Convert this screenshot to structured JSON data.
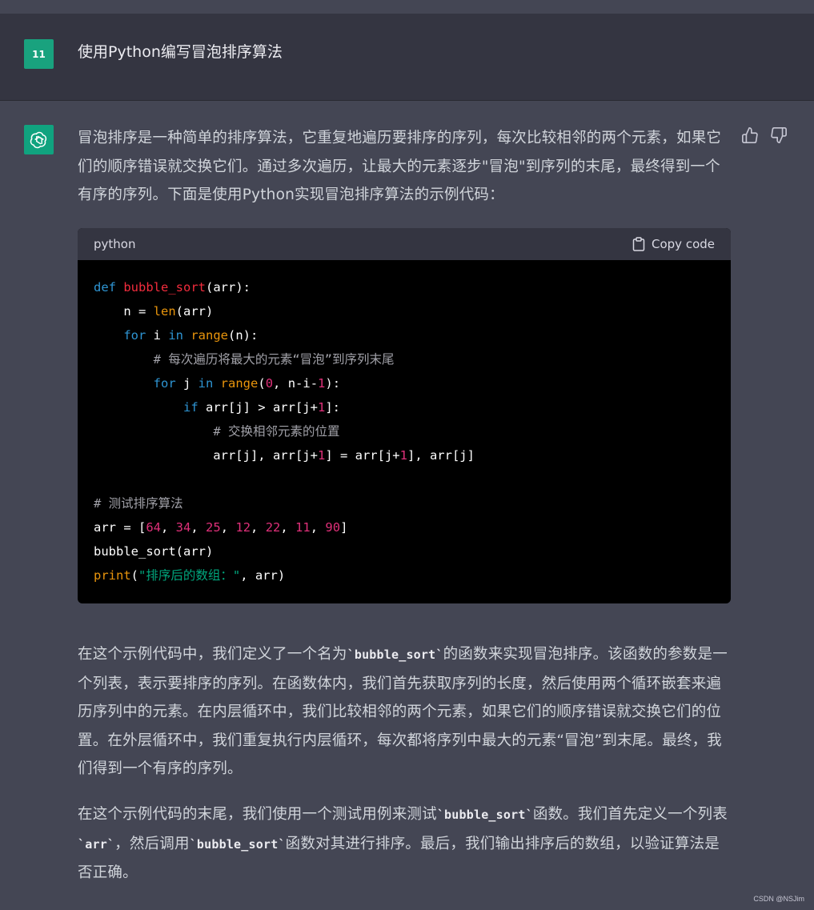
{
  "user_message": {
    "avatar_text": "11",
    "text": "使用Python编写冒泡排序算法"
  },
  "assistant": {
    "avatar_icon": "openai-logo-icon",
    "intro": "冒泡排序是一种简单的排序算法，它重复地遍历要排序的序列，每次比较相邻的两个元素，如果它们的顺序错误就交换它们。通过多次遍历，让最大的元素逐步\"冒泡\"到序列的末尾，最终得到一个有序的序列。下面是使用Python实现冒泡排序算法的示例代码：",
    "code": {
      "language": "python",
      "copy_label": "Copy code",
      "lines": [
        "def bubble_sort(arr):",
        "    n = len(arr)",
        "    for i in range(n):",
        "        # 每次遍历将最大的元素“冒泡”到序列末尾",
        "        for j in range(0, n-i-1):",
        "            if arr[j] > arr[j+1]:",
        "                # 交换相邻元素的位置",
        "                arr[j], arr[j+1] = arr[j+1], arr[j]",
        "",
        "# 测试排序算法",
        "arr = [64, 34, 25, 12, 22, 11, 90]",
        "bubble_sort(arr)",
        "print(\"排序后的数组：\", arr)"
      ]
    },
    "para2": {
      "a": "在这个示例代码中，我们定义了一个名为",
      "code1": "`bubble_sort`",
      "b": "的函数来实现冒泡排序。该函数的参数是一个列表，表示要排序的序列。在函数体内，我们首先获取序列的长度，然后使用两个循环嵌套来遍历序列中的元素。在内层循环中，我们比较相邻的两个元素，如果它们的顺序错误就交换它们的位置。在外层循环中，我们重复执行内层循环，每次都将序列中最大的元素“冒泡”到末尾。最终，我们得到一个有序的序列。"
    },
    "para3": {
      "a": "在这个示例代码的末尾，我们使用一个测试用例来测试",
      "code1": "`bubble_sort`",
      "b": "函数。我们首先定义一个列表",
      "code2": "`arr`",
      "c": "，然后调用",
      "code3": "`bubble_sort`",
      "d": "函数对其进行排序。最后，我们输出排序后的数组，以验证算法是否正确。"
    }
  },
  "feedback": {
    "like_icon": "thumbs-up-icon",
    "dislike_icon": "thumbs-down-icon"
  },
  "watermark": "CSDN @NSJim"
}
